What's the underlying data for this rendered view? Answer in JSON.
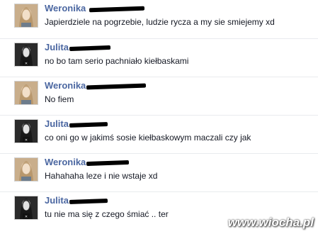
{
  "messages": [
    {
      "sender": "Weronika",
      "avatar": "weronika-avatar",
      "text": "Japierdziele na pogrzebie, ludzie rycza a my sie smiejemy xd"
    },
    {
      "sender": "Julita",
      "avatar": "julita-avatar",
      "text": "no bo tam serio pachniało kiełbaskami"
    },
    {
      "sender": "Weronika",
      "avatar": "weronika-avatar",
      "text": "No fiem"
    },
    {
      "sender": "Julita",
      "avatar": "julita-avatar",
      "text": "co oni go w jakimś sosie kiełbaskowym maczali czy jak"
    },
    {
      "sender": "Weronika",
      "avatar": "weronika-avatar",
      "text": "Hahahaha leze i nie wstaje xd"
    },
    {
      "sender": "Julita",
      "avatar": "julita-avatar",
      "text": "tu nie ma się z czego śmiać .. ter"
    }
  ],
  "watermark": "www.wiocha.pl",
  "colors": {
    "name": "#4b67a1",
    "text": "#141823",
    "divider": "#e9ebee"
  }
}
